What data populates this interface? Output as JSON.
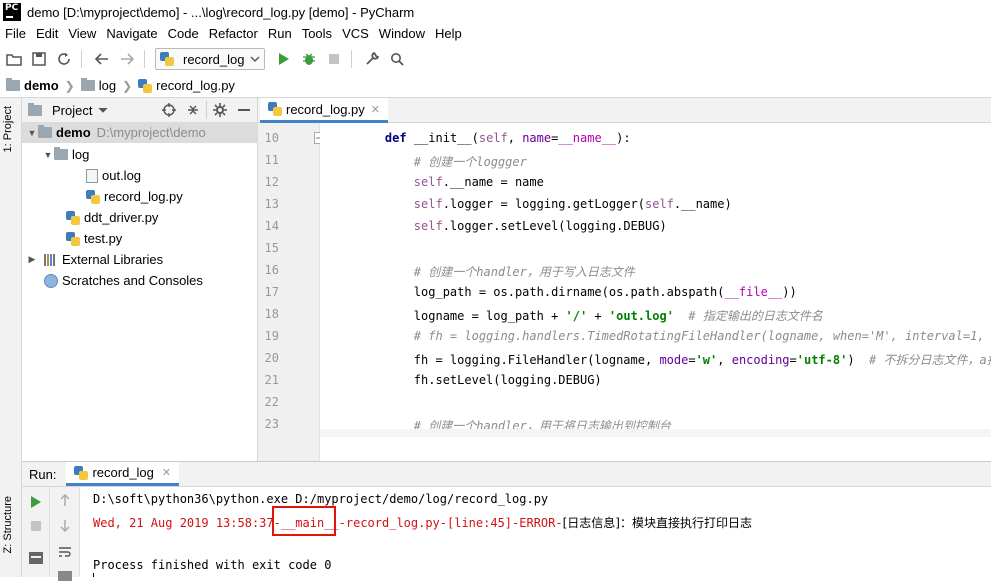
{
  "window": {
    "title": "demo [D:\\myproject\\demo] - ...\\log\\record_log.py [demo] - PyCharm",
    "logo_text": "PC"
  },
  "menu": [
    "File",
    "Edit",
    "View",
    "Navigate",
    "Code",
    "Refactor",
    "Run",
    "Tools",
    "VCS",
    "Window",
    "Help"
  ],
  "toolbar": {
    "run_config": "record_log"
  },
  "breadcrumb": [
    "demo",
    "log",
    "record_log.py"
  ],
  "left_strip": {
    "project_tab": "1: Project",
    "structure_tab": "Z: Structure"
  },
  "project": {
    "header": "Project",
    "tree": [
      {
        "label": "demo",
        "note": "D:\\myproject\\demo"
      },
      {
        "label": "log"
      },
      {
        "label": "out.log"
      },
      {
        "label": "record_log.py"
      },
      {
        "label": "ddt_driver.py"
      },
      {
        "label": "test.py"
      },
      {
        "label": "External Libraries"
      },
      {
        "label": "Scratches and Consoles"
      }
    ]
  },
  "editor": {
    "tab": "record_log.py",
    "line_numbers": [
      "10",
      "11",
      "12",
      "13",
      "14",
      "15",
      "16",
      "17",
      "18",
      "19",
      "20",
      "21",
      "22",
      "23"
    ],
    "lines": [
      "    def __init__(self, name=__name__):",
      "        # 创建一个loggger",
      "        self.__name = name",
      "        self.logger = logging.getLogger(self.__name)",
      "        self.logger.setLevel(logging.DEBUG)",
      "",
      "        # 创建一个handler，用于写入日志文件",
      "        log_path = os.path.dirname(os.path.abspath(__file__))",
      "        logname = log_path + '/' + 'out.log'  # 指定输出的日志文件名",
      "        # fh = logging.handlers.TimedRotatingFileHandler(logname, when='M', interval=1, backupCount",
      "        fh = logging.FileHandler(logname, mode='w', encoding='utf-8')  # 不拆分日志文件，a指追加",
      "        fh.setLevel(logging.DEBUG)",
      "",
      "        # 创建一个handler，用于将日志输出到控制台"
    ]
  },
  "run": {
    "label": "Run:",
    "tab": "record_log",
    "console": {
      "cmd": "D:\\soft\\python36\\python.exe D:/myproject/demo/log/record_log.py",
      "log_prefix": "Wed, 21 Aug 2019 13:58:37-",
      "log_main": "__main__",
      "log_mid": "-record_log.py-[line:45]-ERROR-",
      "log_msg": "[日志信息]：模块直接执行打印日志",
      "finish": "Process finished with exit code 0"
    }
  },
  "colors": {
    "keyword": "#000080",
    "self": "#94558d",
    "comment": "#8c8c8c",
    "string": "#008000",
    "error": "#d21313",
    "highlight_box": "#e0140a",
    "tab_underline": "#4083c9"
  }
}
